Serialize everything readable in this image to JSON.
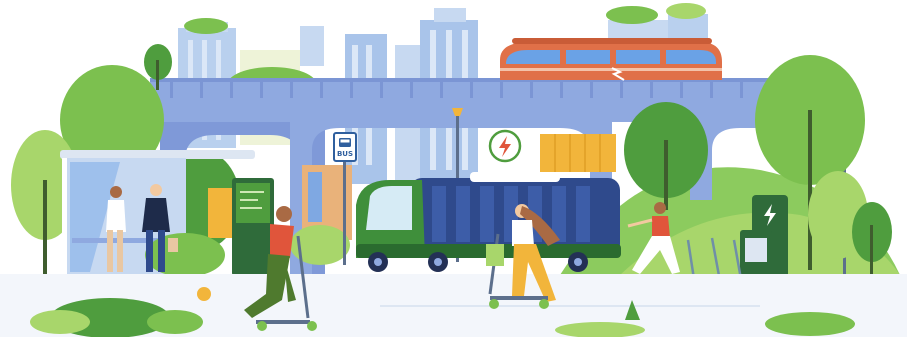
{
  "scene": {
    "bus_stop_sign": "BUS"
  },
  "icons": {
    "charging_badge": "lightning-bolt-icon",
    "charger_station": "lightning-bolt-icon",
    "bus_stop": "bus-icon"
  },
  "palette": {
    "sky_building": "#a9c4ea",
    "building_light": "#c7d9f1",
    "overpass": "#8fa9e0",
    "train_body": "#e07048",
    "train_window": "#6aa2e6",
    "tree_dark": "#4f9d3e",
    "tree_mid": "#7cc04f",
    "tree_light": "#a8d66b",
    "grass": "#7fc35a",
    "bus_body": "#2f4a8c",
    "bus_cab": "#3f8f3b",
    "crate": "#f2b53b",
    "road": "#f3f6fb",
    "accent_red": "#e0553b"
  }
}
